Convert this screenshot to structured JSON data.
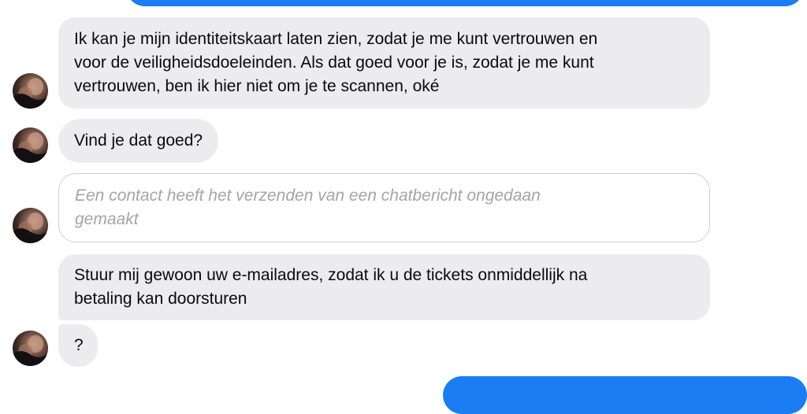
{
  "chat": {
    "messages": [
      {
        "text": "Ik kan je mijn identiteitskaart laten zien, zodat je me kunt vertrouwen en\nvoor de veiligheidsdoeleinden. Als dat goed voor je is, zodat je me kunt\nvertrouwen, ben ik hier niet om je te scannen, oké"
      },
      {
        "text": "Vind je dat goed?"
      },
      {
        "text": "Een contact heeft het verzenden van een chatbericht ongedaan\ngemaakt"
      },
      {
        "text": "Stuur mij gewoon uw e-mailadres, zodat ik u de tickets onmiddellijk na\nbetaling kan doorsturen"
      },
      {
        "text": "?"
      }
    ]
  },
  "colors": {
    "sent_bubble": "#1b7cf3",
    "received_bubble": "#ececee",
    "unsent_border": "#cfcfd3",
    "unsent_text": "#a4a4aa"
  }
}
